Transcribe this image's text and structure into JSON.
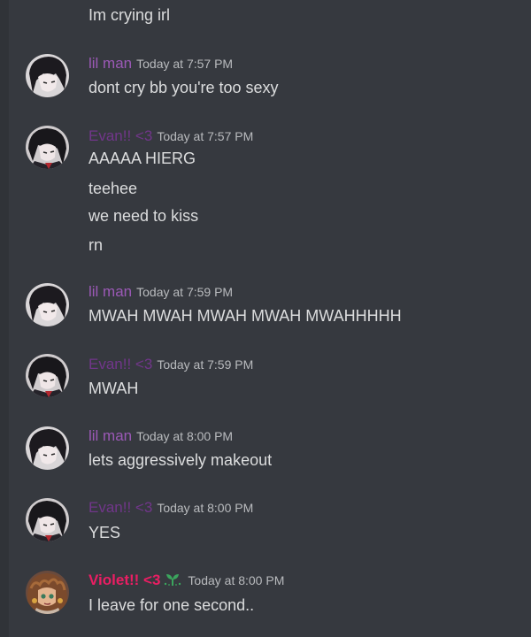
{
  "colors": {
    "background": "#36393f",
    "text": "#dcddde",
    "timestamp": "#b9bbbe",
    "lilman": "#9b59b6",
    "evan": "#71368a",
    "violet": "#e91e63"
  },
  "messages": {
    "m0": {
      "lines": [
        "Im crying irl"
      ]
    },
    "m1": {
      "username": "lil man",
      "timestamp": "Today at 7:57 PM",
      "avatar_icon": "dark-hair-avatar-icon",
      "lines": [
        "dont cry bb you're too sexy"
      ]
    },
    "m2": {
      "username": "Evan!! <3",
      "timestamp": "Today at 7:57 PM",
      "avatar_icon": "dark-hair-red-collar-avatar-icon",
      "lines": [
        "AAAAA HIERG",
        "teehee",
        "we need to kiss",
        "rn"
      ]
    },
    "m3": {
      "username": "lil man",
      "timestamp": "Today at 7:59 PM",
      "avatar_icon": "dark-hair-avatar-icon",
      "lines": [
        "MWAH MWAH MWAH MWAH MWAHHHHH"
      ]
    },
    "m4": {
      "username": "Evan!! <3",
      "timestamp": "Today at 7:59 PM",
      "avatar_icon": "dark-hair-red-collar-avatar-icon",
      "lines": [
        "MWAH"
      ]
    },
    "m5": {
      "username": "lil man",
      "timestamp": "Today at 8:00 PM",
      "avatar_icon": "dark-hair-avatar-icon",
      "lines": [
        "lets aggressively makeout"
      ]
    },
    "m6": {
      "username": "Evan!! <3",
      "timestamp": "Today at 8:00 PM",
      "avatar_icon": "dark-hair-red-collar-avatar-icon",
      "lines": [
        "YES"
      ]
    },
    "m7": {
      "username": "Violet!! <3",
      "timestamp": "Today at 8:00 PM",
      "avatar_icon": "brown-hair-avatar-icon",
      "badge_icon": "sprout-icon",
      "lines": [
        "I leave for one second.."
      ]
    }
  }
}
